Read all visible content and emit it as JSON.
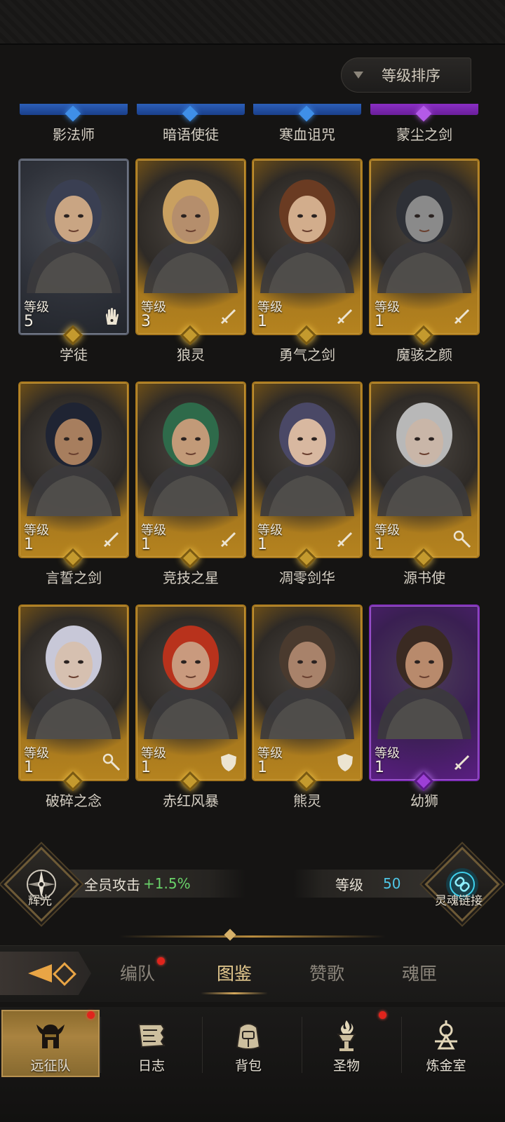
{
  "sort": {
    "label": "等级排序"
  },
  "top_row": [
    {
      "name": "影法师",
      "tier": "blue"
    },
    {
      "name": "暗语使徒",
      "tier": "blue"
    },
    {
      "name": "寒血诅咒",
      "tier": "blue"
    },
    {
      "name": "蒙尘之剑",
      "tier": "purple"
    }
  ],
  "heroes": [
    {
      "name": "学徒",
      "level_label": "等级",
      "level": "5",
      "tier": "blue",
      "role_icon": "hand-icon"
    },
    {
      "name": "狼灵",
      "level_label": "等级",
      "level": "3",
      "tier": "gold",
      "role_icon": "sword-icon"
    },
    {
      "name": "勇气之剑",
      "level_label": "等级",
      "level": "1",
      "tier": "gold",
      "role_icon": "sword-icon"
    },
    {
      "name": "魔骇之颜",
      "level_label": "等级",
      "level": "1",
      "tier": "gold",
      "role_icon": "sword-icon"
    },
    {
      "name": "言誓之剑",
      "level_label": "等级",
      "level": "1",
      "tier": "gold",
      "role_icon": "sword-icon"
    },
    {
      "name": "竞技之星",
      "level_label": "等级",
      "level": "1",
      "tier": "gold",
      "role_icon": "sword-icon"
    },
    {
      "name": "凋零剑华",
      "level_label": "等级",
      "level": "1",
      "tier": "gold",
      "role_icon": "sword-icon"
    },
    {
      "name": "源书使",
      "level_label": "等级",
      "level": "1",
      "tier": "gold",
      "role_icon": "staff-icon"
    },
    {
      "name": "破碎之念",
      "level_label": "等级",
      "level": "1",
      "tier": "gold",
      "role_icon": "staff-icon"
    },
    {
      "name": "赤红风暴",
      "level_label": "等级",
      "level": "1",
      "tier": "gold",
      "role_icon": "shield-icon"
    },
    {
      "name": "熊灵",
      "level_label": "等级",
      "level": "1",
      "tier": "gold",
      "role_icon": "shield-icon"
    },
    {
      "name": "幼狮",
      "level_label": "等级",
      "level": "1",
      "tier": "purple",
      "role_icon": "sword-icon"
    }
  ],
  "bonus": {
    "left_caption": "辉光",
    "stat_label": "全员攻击",
    "stat_value": "+1.5%",
    "level_label": "等级",
    "level_value": "50",
    "right_caption": "灵魂链接"
  },
  "tabs": [
    {
      "label": "编队",
      "badge": true
    },
    {
      "label": "图鉴",
      "active": true
    },
    {
      "label": "赞歌"
    },
    {
      "label": "魂匣"
    }
  ],
  "nav": [
    {
      "label": "远征队",
      "icon": "helmet-icon",
      "active": true,
      "badge": true
    },
    {
      "label": "日志",
      "icon": "scroll-icon"
    },
    {
      "label": "背包",
      "icon": "bag-icon"
    },
    {
      "label": "圣物",
      "icon": "brazier-icon",
      "badge": true
    },
    {
      "label": "炼金室",
      "icon": "alchemy-icon"
    }
  ],
  "colors": {
    "gold_frame": "#a8781d",
    "purple_frame": "#7d2db6",
    "blue_frame": "#5c6270",
    "accent_green": "#6ad36a",
    "accent_cyan": "#4fc6e6",
    "tab_active": "#e4c98e"
  }
}
